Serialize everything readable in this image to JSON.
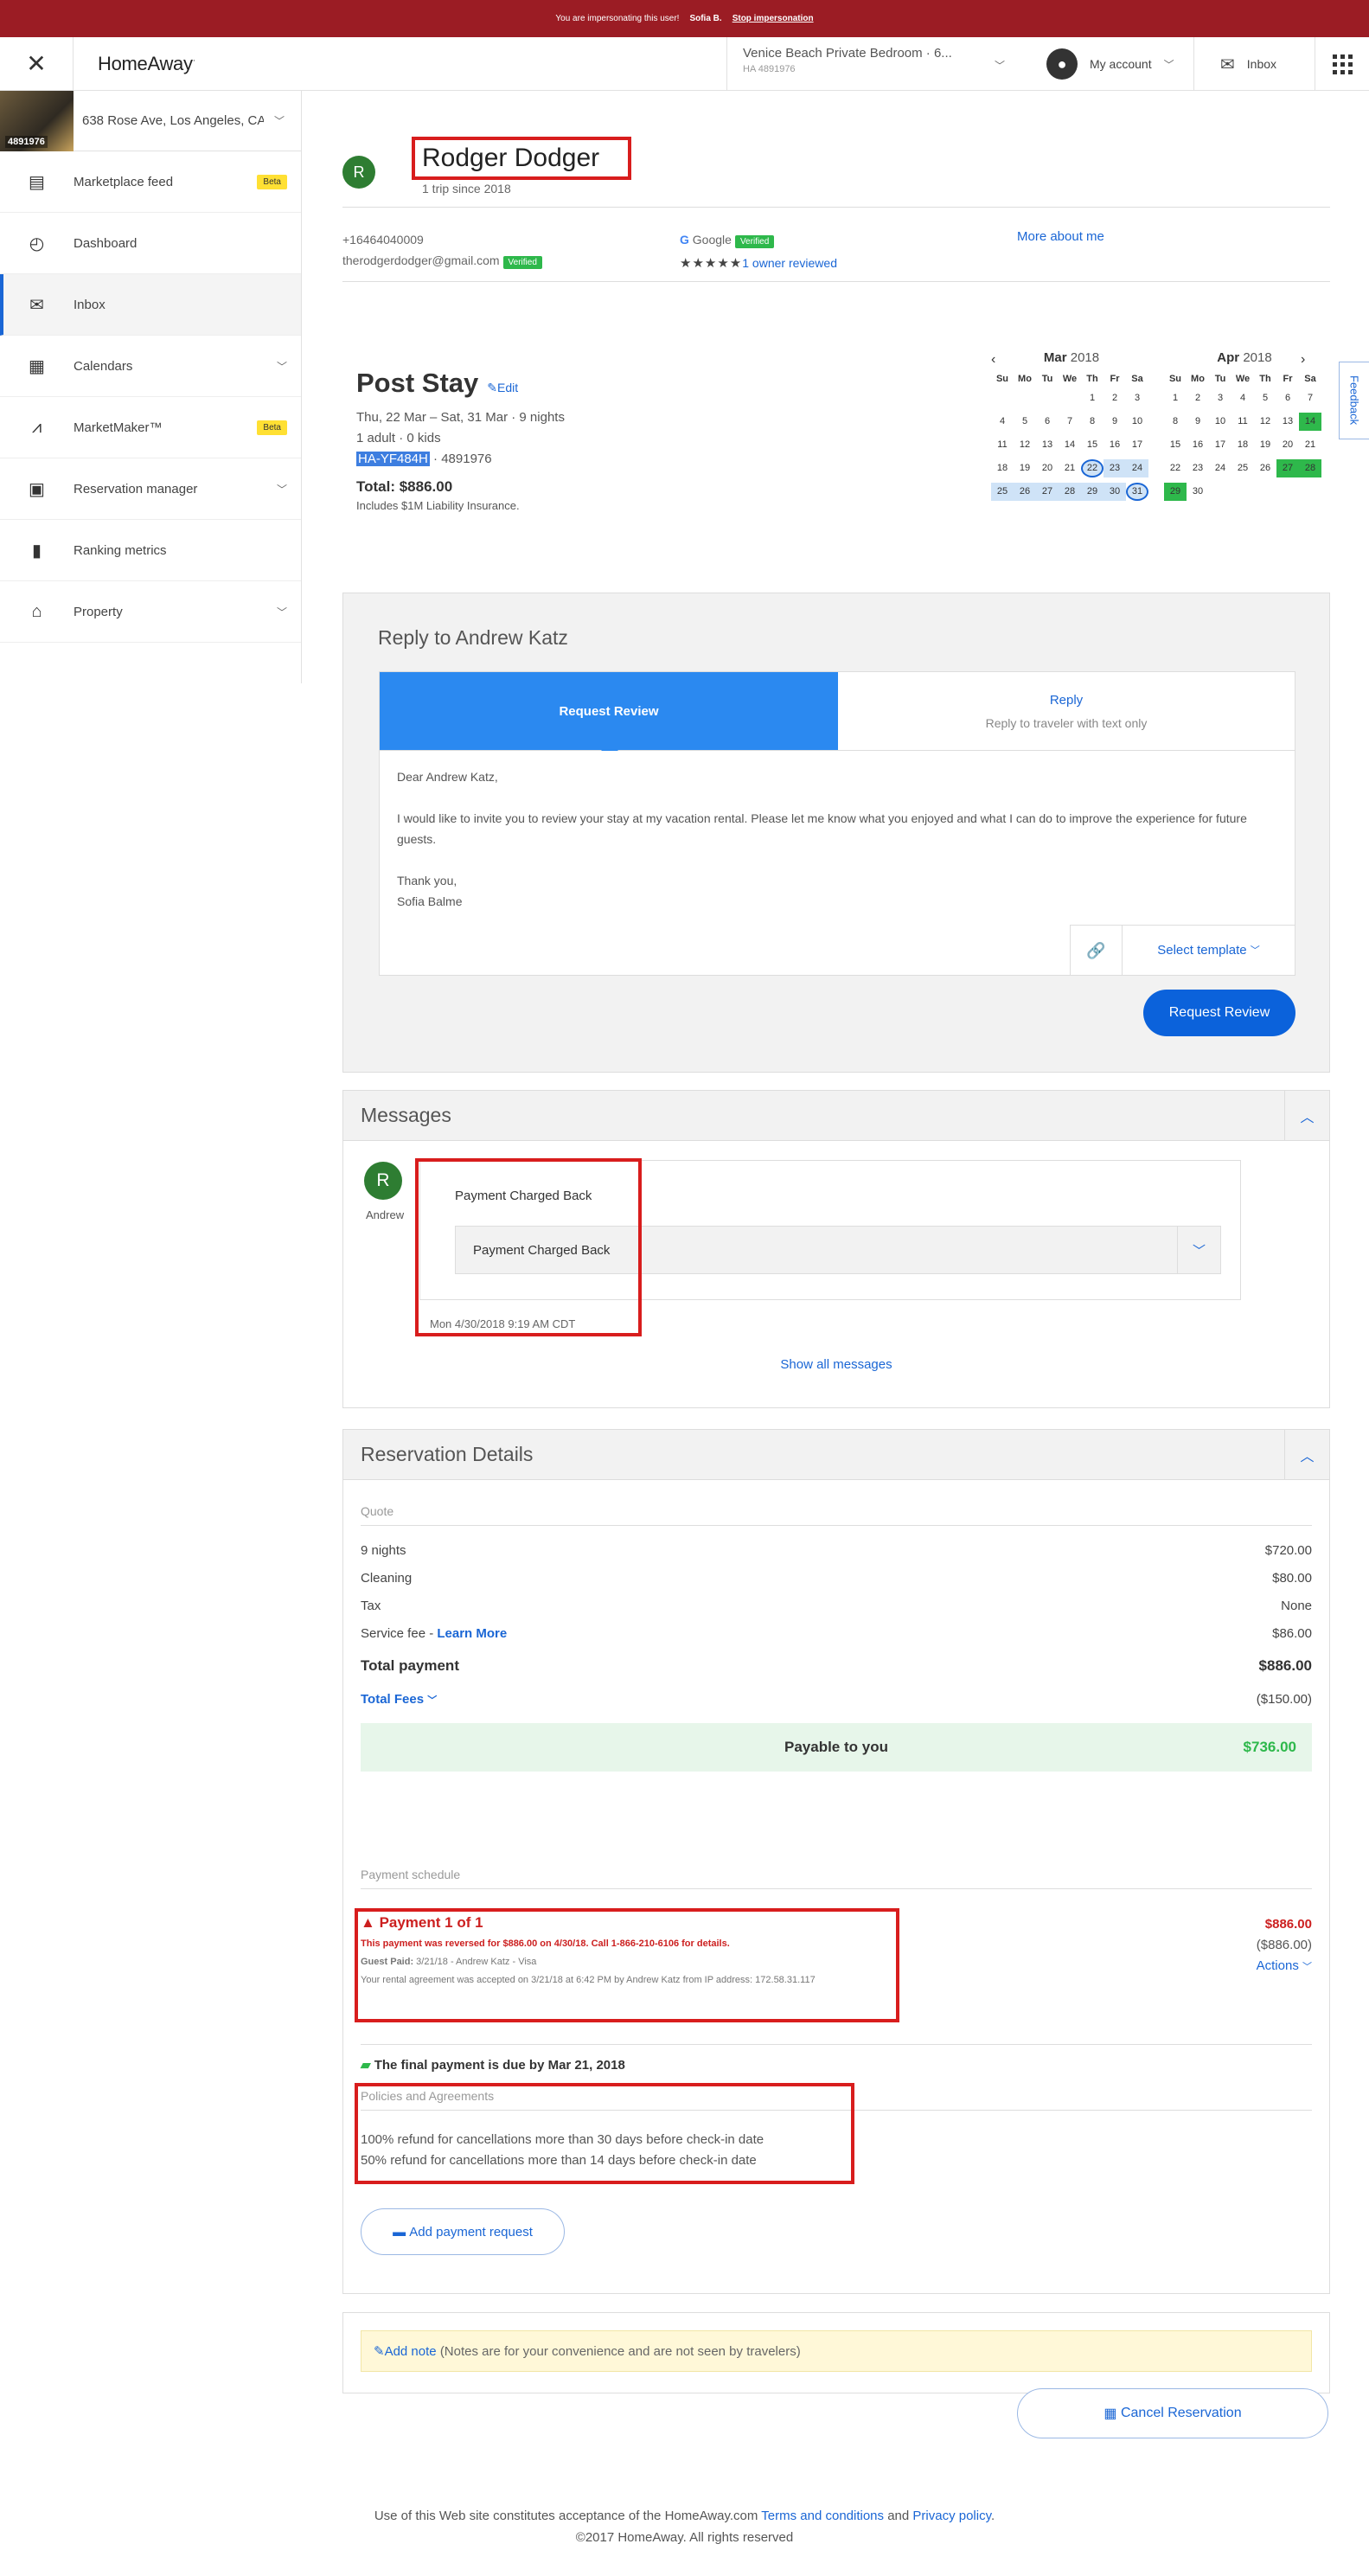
{
  "banner": {
    "text": "You are impersonating this user!",
    "user": "Sofia B.",
    "stop": "Stop impersonation"
  },
  "topbar": {
    "logo": "HomeAway",
    "property_title": "Venice Beach Private Bedroom · 6...",
    "property_id": "HA 4891976",
    "account": "My account",
    "inbox": "Inbox"
  },
  "sidebar": {
    "property": {
      "thumb_label": "4891976",
      "address": "638 Rose Ave, Los Angeles, CA"
    },
    "items": [
      {
        "label": "Marketplace feed",
        "badge": "Beta",
        "icon": "newspaper-icon"
      },
      {
        "label": "Dashboard",
        "icon": "dashboard-icon"
      },
      {
        "label": "Inbox",
        "icon": "envelope-icon"
      },
      {
        "label": "Calendars",
        "icon": "calendar-icon"
      },
      {
        "label": "MarketMaker™",
        "badge": "Beta",
        "icon": "chart-line-icon"
      },
      {
        "label": "Reservation manager",
        "icon": "reservation-icon"
      },
      {
        "label": "Ranking metrics",
        "icon": "bar-chart-icon"
      },
      {
        "label": "Property",
        "icon": "home-icon"
      }
    ]
  },
  "guest": {
    "initial": "R",
    "name": "Rodger Dodger",
    "trips": "1 trip since 2018",
    "phone": "+16464040009",
    "email": "therodgerdodger@gmail.com",
    "verified": "Verified",
    "google": "Google",
    "google_verified": "Verified",
    "stars": "★★★★★",
    "reviewed": "1 owner reviewed",
    "more": "More about me"
  },
  "stay": {
    "title": "Post Stay",
    "edit": "Edit",
    "dates": "Thu, 22 Mar – Sat, 31 Mar",
    "nights": "9 nights",
    "adults": "1 adult",
    "kids": "0 kids",
    "res_id": "HA-YF484H",
    "prop_id": "4891976",
    "total": "Total: $886.00",
    "insurance": "Includes $1M Liability Insurance."
  },
  "calendar": {
    "weekdays": [
      "Su",
      "Mo",
      "Tu",
      "We",
      "Th",
      "Fr",
      "Sa"
    ],
    "months": [
      {
        "name": "Mar",
        "year": "2018"
      },
      {
        "name": "Apr",
        "year": "2018"
      }
    ]
  },
  "feedback": "Feedback",
  "reply": {
    "title": "Reply to Andrew Katz",
    "tab1": "Request Review",
    "tab2": "Reply",
    "tab2_sub": "Reply to traveler with text only",
    "greeting": "Dear Andrew Katz,",
    "body": "I would like to invite you to review your stay at my vacation rental. Please let me know what you enjoyed and what I can do to improve the experience for future guests.",
    "thanks": "Thank you,",
    "sign": "Sofia Balme",
    "template": "Select template",
    "button": "Request Review"
  },
  "messages": {
    "title": "Messages",
    "initial": "R",
    "who": "Andrew",
    "subject": "Payment Charged Back",
    "inner": "Payment Charged Back",
    "date": "Mon 4/30/2018 9:19 AM CDT",
    "show_all": "Show all messages"
  },
  "reservation": {
    "title": "Reservation Details",
    "quote_label": "Quote",
    "lines": [
      {
        "label": "9 nights",
        "value": "$720.00"
      },
      {
        "label": "Cleaning",
        "value": "$80.00"
      },
      {
        "label": "Tax",
        "value": "None"
      },
      {
        "label": "Service fee - ",
        "link": "Learn More",
        "value": "$86.00"
      }
    ],
    "total_label": "Total payment",
    "total_value": "$886.00",
    "fees_label": "Total Fees",
    "fees_value": "($150.00)",
    "payable_label": "Payable to you",
    "payable_value": "$736.00",
    "schedule_label": "Payment schedule",
    "payment_title": "Payment 1 of 1",
    "payment_note": "This payment was reversed for $886.00 on 4/30/18. Call 1-866-210-6106 for details.",
    "guest_paid_label": "Guest Paid:",
    "guest_paid": " 3/21/18 - Andrew Katz - Visa",
    "agreement": "Your rental agreement was accepted on 3/21/18 at 6:42 PM by Andrew Katz from IP address: 172.58.31.117",
    "payment_amount": "$886.00",
    "payment_reversed": "($886.00)",
    "actions": "Actions",
    "final_due": "The final payment is due by Mar 21, 2018",
    "policies_label": "Policies and Agreements",
    "policy1": "100% refund for cancellations more than 30 days before check-in date",
    "policy2": "50% refund for cancellations more than 14 days before check-in date",
    "add_payment": "Add payment request"
  },
  "note": {
    "link": "Add note",
    "text": "(Notes are for your convenience and are not seen by travelers)"
  },
  "cancel": "Cancel Reservation",
  "footer": {
    "pre": "Use of this Web site constitutes acceptance of the HomeAway.com ",
    "terms": "Terms and conditions",
    "and": " and ",
    "privacy": "Privacy policy",
    "dot": ".",
    "copy": "©2017 HomeAway. All rights reserved"
  }
}
